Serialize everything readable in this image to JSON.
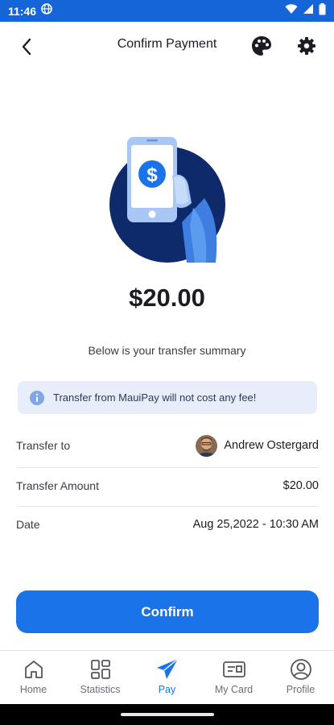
{
  "status_bar": {
    "time": "11:46"
  },
  "header": {
    "title": "Confirm Payment"
  },
  "payment": {
    "amount": "$20.00",
    "summary": "Below is your transfer summary",
    "info": "Transfer from MauiPay will not cost any fee!"
  },
  "details": [
    {
      "label": "Transfer to",
      "value": "Andrew Ostergard"
    },
    {
      "label": "Transfer Amount",
      "value": "$20.00"
    },
    {
      "label": "Date",
      "value": "Aug 25,2022 - 10:30 AM"
    }
  ],
  "confirm_label": "Confirm",
  "nav": [
    {
      "label": "Home",
      "icon": "home-icon"
    },
    {
      "label": "Statistics",
      "icon": "statistics-icon"
    },
    {
      "label": "Pay",
      "icon": "paper-plane-icon",
      "active": true
    },
    {
      "label": "My Card",
      "icon": "card-icon"
    },
    {
      "label": "Profile",
      "icon": "profile-icon"
    }
  ],
  "colors": {
    "primary": "#1a73e8",
    "status_bar": "#1565d8",
    "hero_circle": "#0f2a6b",
    "info_bg": "#e7eef9"
  }
}
